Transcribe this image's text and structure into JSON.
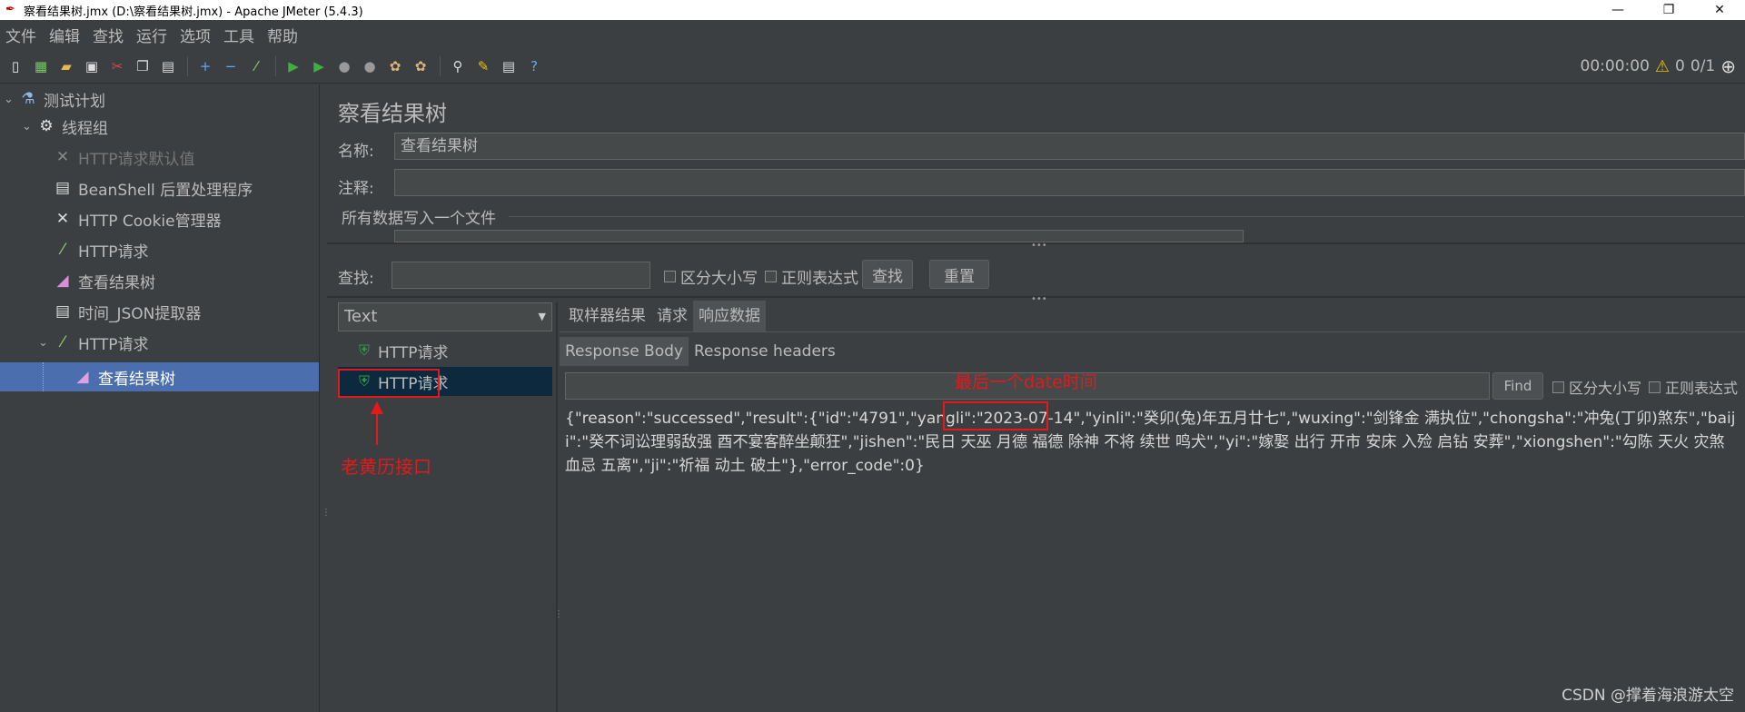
{
  "window": {
    "title": "察看结果树.jmx (D:\\察看结果树.jmx) - Apache JMeter (5.4.3)",
    "controls": [
      "—",
      "❐",
      "✕"
    ]
  },
  "menu": [
    "文件",
    "编辑",
    "查找",
    "运行",
    "选项",
    "工具",
    "帮助"
  ],
  "toolbar": {
    "timer": "00:00:00",
    "warnings": "0",
    "threads": "0/1"
  },
  "tree": [
    {
      "label": "测试计划",
      "icon": "flask-icon",
      "level": 0,
      "expanded": true
    },
    {
      "label": "线程组",
      "icon": "gear-icon",
      "level": 1,
      "expanded": true
    },
    {
      "label": "HTTP请求默认值",
      "icon": "tools-icon",
      "level": 2,
      "disabled": true
    },
    {
      "label": "BeanShell 后置处理程序",
      "icon": "script-icon",
      "level": 2
    },
    {
      "label": "HTTP Cookie管理器",
      "icon": "tools-icon",
      "level": 2
    },
    {
      "label": "HTTP请求",
      "icon": "pipette-icon",
      "level": 2
    },
    {
      "label": "查看结果树",
      "icon": "chart-icon",
      "level": 2
    },
    {
      "label": "时间_JSON提取器",
      "icon": "script-icon",
      "level": 2
    },
    {
      "label": "HTTP请求",
      "icon": "pipette-icon",
      "level": 2,
      "expanded": true
    },
    {
      "label": "查看结果树",
      "icon": "chart-icon",
      "level": 3,
      "selected": true
    }
  ],
  "panel": {
    "title": "察看结果树",
    "name_label": "名称:",
    "name_value": "查看结果树",
    "comment_label": "注释:",
    "comment_value": "",
    "fileset_title": "所有数据写入一个文件",
    "search_label": "查找:",
    "search_value": "",
    "case_sensitive": "区分大小写",
    "regex": "正则表达式",
    "search_button": "查找",
    "reset_button": "重置"
  },
  "results": {
    "renderer": "Text",
    "samples": [
      {
        "label": "HTTP请求",
        "status": "success"
      },
      {
        "label": "HTTP请求",
        "status": "success",
        "selected": true
      }
    ],
    "tabs": [
      "取样器结果",
      "请求",
      "响应数据"
    ],
    "active_tab": "响应数据",
    "subtabs": [
      "Response Body",
      "Response headers"
    ],
    "active_subtab": "Response Body",
    "find_value": "",
    "find_button": "Find",
    "find_case": "区分大小写",
    "find_regex": "正则表达式",
    "response_text_before": "{\"reason\":\"successed\",\"result\":{\"id\":\"4791\",\"yangli\":\"",
    "response_date": "2023-07-14",
    "response_text_after": "\",\"yinli\":\"癸卯(兔)年五月廿七\",\"wuxing\":\"剑锋金 满执位\",\"chongsha\":\"冲兔(丁卯)煞东\",\"baiji\":\"癸不词讼理弱敌强 酉不宴客醉坐颠狂\",\"jishen\":\"民日 天巫 月德 福德 除神 不将 续世 鸣犬\",\"yi\":\"嫁娶 出行 开市 安床 入殓 启钻 安葬\",\"xiongshen\":\"勾陈 天火 灾煞 血忌 五离\",\"ji\":\"祈福 动土 破土\"},\"error_code\":0}"
  },
  "annotations": {
    "arrow_label": "老黄历接口",
    "date_label": "最后一个date时间"
  },
  "watermark": "CSDN @撑着海浪游太空",
  "colors": {
    "background": "#3c3f41",
    "selection": "#4b6eaf",
    "annotation": "#e51919"
  }
}
